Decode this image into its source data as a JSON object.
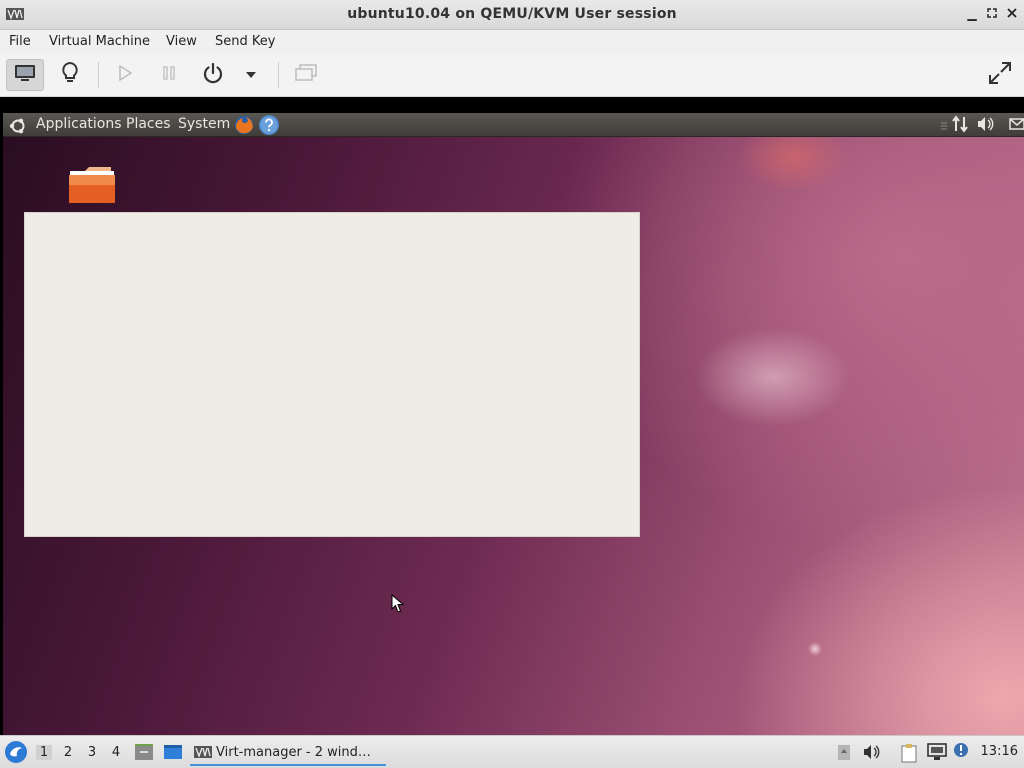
{
  "window": {
    "title": "ubuntu10.04 on QEMU/KVM User session",
    "controls": [
      "minimize",
      "maximize",
      "close"
    ]
  },
  "menubar": {
    "items": [
      "File",
      "Virtual Machine",
      "View",
      "Send Key"
    ]
  },
  "toolbar": {
    "buttons": [
      {
        "icon": "monitor-icon",
        "state": "active"
      },
      {
        "icon": "lightbulb-icon"
      },
      {
        "icon": "play-icon",
        "state": "disabled"
      },
      {
        "icon": "pause-icon",
        "state": "disabled"
      },
      {
        "icon": "power-icon"
      },
      {
        "icon": "dropdown-arrow-icon"
      },
      {
        "icon": "snapshots-icon",
        "state": "disabled"
      },
      {
        "icon": "fullscreen-icon"
      }
    ]
  },
  "guest": {
    "panel": {
      "menus": [
        "Applications",
        "Places",
        "System"
      ],
      "launchers": [
        "firefox-icon",
        "help-icon"
      ],
      "tray": [
        "network-icon",
        "volume-icon",
        "mail-icon"
      ]
    },
    "desktop": {
      "folder_icon": "folder-icon"
    }
  },
  "taskbar": {
    "workspaces": [
      "1",
      "2",
      "3",
      "4"
    ],
    "active_workspace": "1",
    "task_label": "Virt-manager - 2 wind…",
    "clock": "13:16",
    "tray_icons": [
      "notes-icon",
      "volume-icon",
      "clipboard-icon",
      "network-icon",
      "notification-icon"
    ]
  },
  "colors": {
    "accent": "#4a90d9",
    "desktop_dark": "#2a0d22",
    "desktop_light": "#c07690",
    "panel": "#4a4844",
    "dialog": "#efebe5"
  }
}
